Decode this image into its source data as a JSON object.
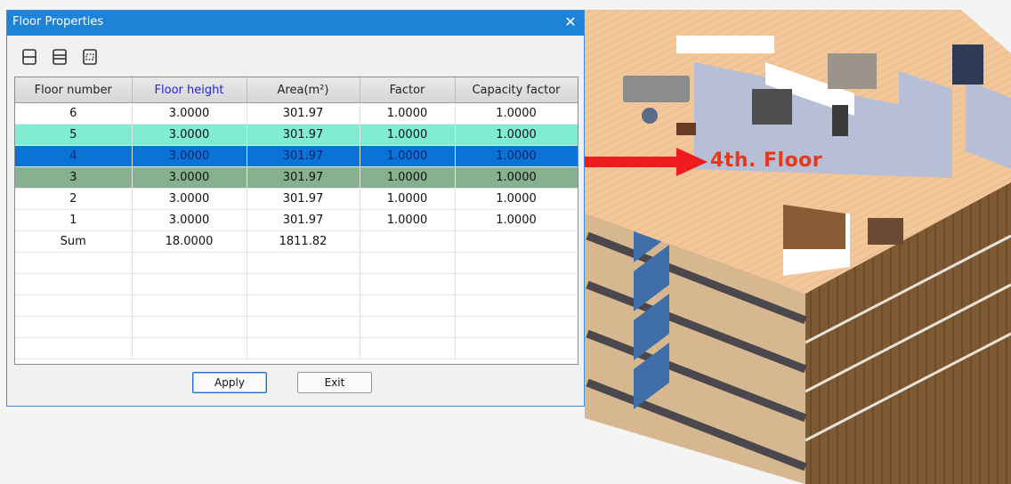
{
  "dialog": {
    "title": "Floor Properties",
    "close_glyph": "✕",
    "toolbar": [
      {
        "icon": "insert-floor-icon"
      },
      {
        "icon": "split-floor-icon"
      },
      {
        "icon": "delete-floor-icon"
      }
    ],
    "table": {
      "columns": [
        "Floor number",
        "Floor height",
        "Area(m²)",
        "Factor",
        "Capacity factor"
      ],
      "rows": [
        [
          "6",
          "3.0000",
          "301.97",
          "1.0000",
          "1.0000"
        ],
        [
          "5",
          "3.0000",
          "301.97",
          "1.0000",
          "1.0000"
        ],
        [
          "4",
          "3.0000",
          "301.97",
          "1.0000",
          "1.0000"
        ],
        [
          "3",
          "3.0000",
          "301.97",
          "1.0000",
          "1.0000"
        ],
        [
          "2",
          "3.0000",
          "301.97",
          "1.0000",
          "1.0000"
        ],
        [
          "1",
          "3.0000",
          "301.97",
          "1.0000",
          "1.0000"
        ],
        [
          "Sum",
          "18.0000",
          "1811.82",
          "",
          ""
        ]
      ]
    },
    "apply_label": "Apply",
    "exit_label": "Exit"
  },
  "annotation": {
    "label": "4th. Floor",
    "color": "#e8381c"
  },
  "colors": {
    "titlebar": "#1e83d7",
    "row_5": "#80ecd4",
    "row_4_selected": "#0c73d6",
    "row_3": "#86b08e",
    "header_highlight": "#2424d8"
  }
}
